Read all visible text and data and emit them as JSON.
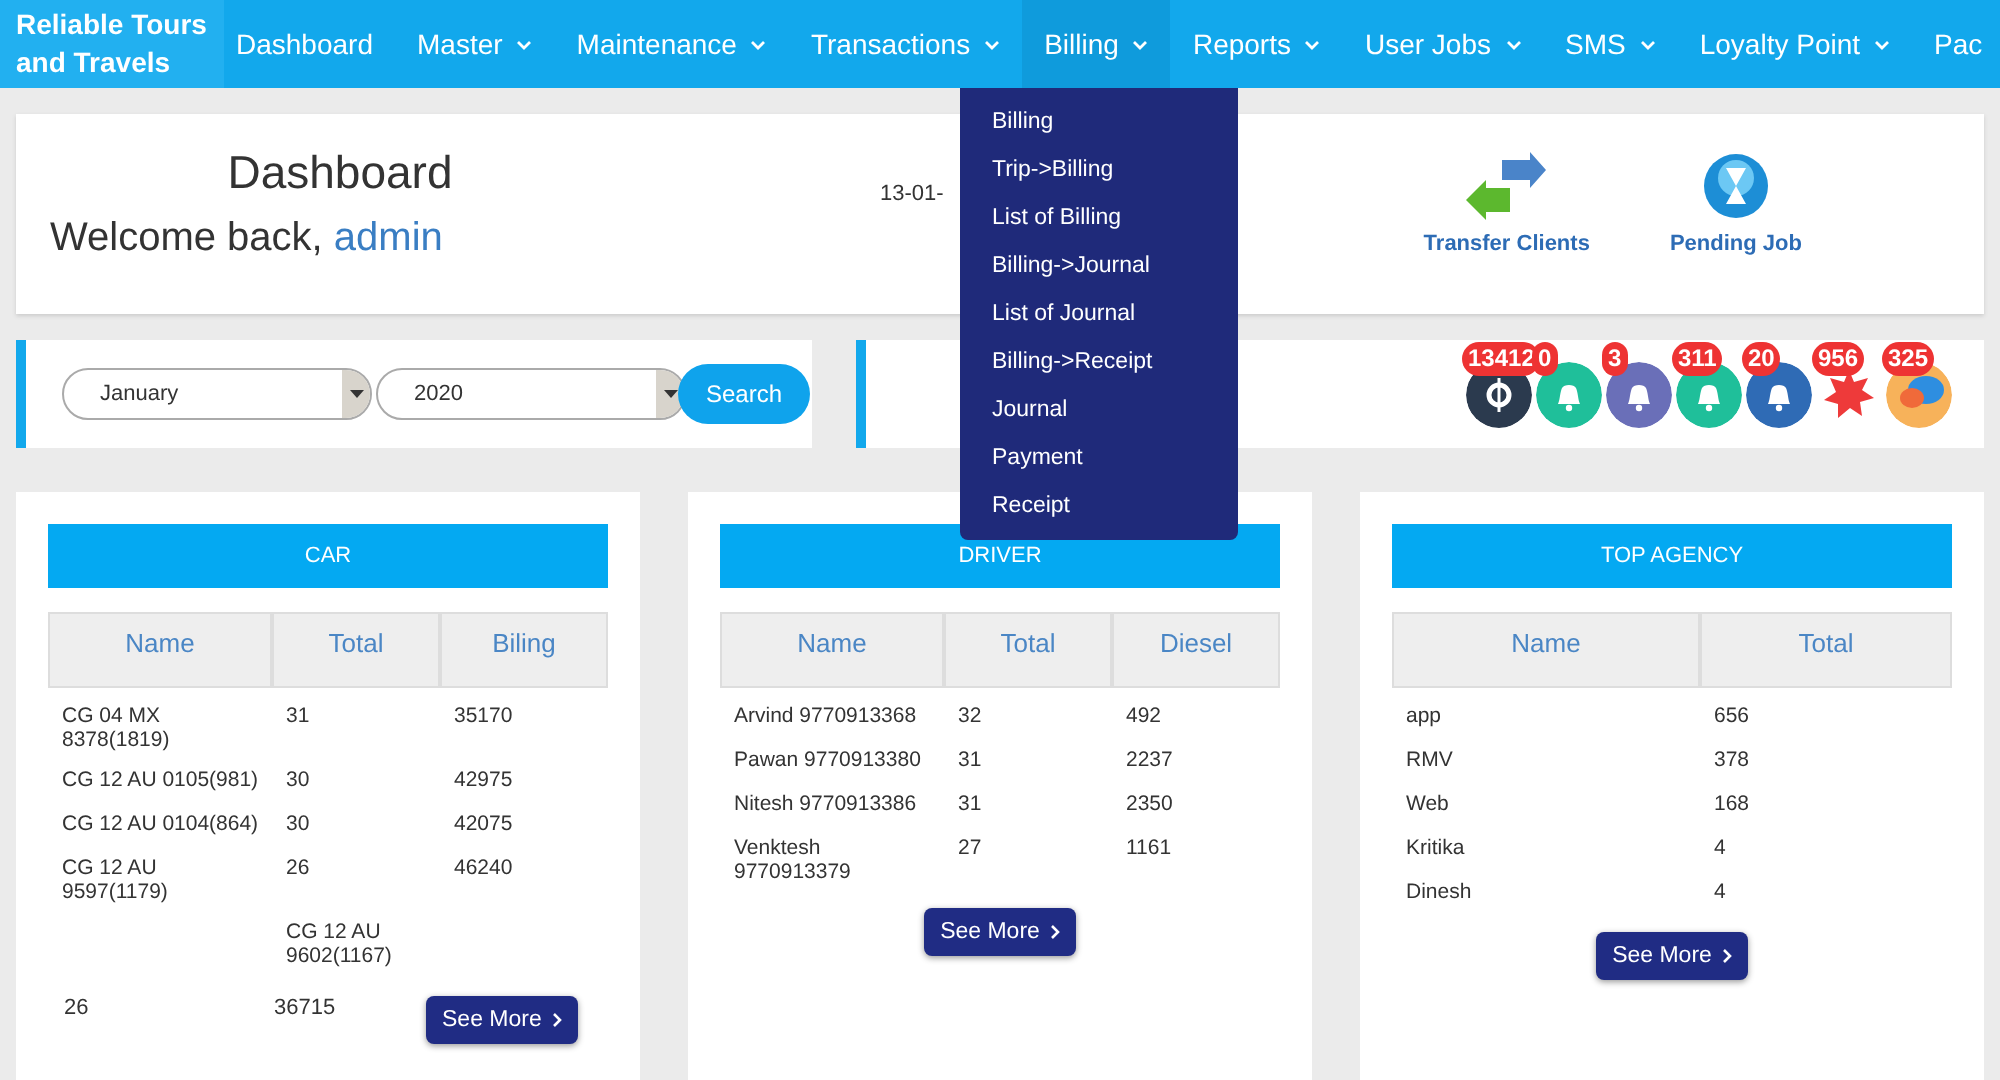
{
  "brand": "Reliable Tours and Travels",
  "nav": [
    {
      "label": "Dashboard",
      "caret": false,
      "expanded": false
    },
    {
      "label": "Master",
      "caret": true,
      "expanded": false
    },
    {
      "label": "Maintenance",
      "caret": true,
      "expanded": false
    },
    {
      "label": "Transactions",
      "caret": true,
      "expanded": false
    },
    {
      "label": "Billing",
      "caret": true,
      "expanded": true
    },
    {
      "label": "Reports",
      "caret": true,
      "expanded": false
    },
    {
      "label": "User Jobs",
      "caret": true,
      "expanded": false
    },
    {
      "label": "SMS",
      "caret": true,
      "expanded": false
    },
    {
      "label": "Loyalty Point",
      "caret": true,
      "expanded": false
    },
    {
      "label": "Pac",
      "caret": false,
      "expanded": false
    }
  ],
  "dropdown": [
    "Billing",
    "Trip->Billing",
    "List of Billing",
    "Billing->Journal",
    "List of Journal",
    "Billing->Receipt",
    "Journal",
    "Payment",
    "Receipt"
  ],
  "header": {
    "title": "Dashboard",
    "welcome": "Welcome back,",
    "user": "admin",
    "date": "13-01-",
    "shortcuts": [
      {
        "kind": "transfer",
        "label": "Transfer Clients"
      },
      {
        "kind": "hourglass",
        "label": "Pending Job"
      }
    ]
  },
  "filter": {
    "month": "January",
    "year": "2020",
    "button": "Search"
  },
  "notifications": [
    {
      "kind": "ring",
      "color": "#2b3a4e",
      "count": "13412"
    },
    {
      "kind": "bell",
      "color": "#1fbf9a",
      "count": "0"
    },
    {
      "kind": "bell",
      "color": "#6a6fb8",
      "count": "3"
    },
    {
      "kind": "bell",
      "color": "#1fbf9a",
      "count": "311"
    },
    {
      "kind": "bell",
      "color": "#2f6bb5",
      "count": "20"
    },
    {
      "kind": "star",
      "color": "#ee3a3a",
      "count": "956"
    },
    {
      "kind": "chat",
      "color": "#f7b25a",
      "count": "325"
    }
  ],
  "cards": [
    {
      "title": "CAR",
      "columns": [
        "Name",
        "Total",
        "Biling"
      ],
      "rows": [
        [
          "CG 04 MX 8378(1819)",
          "31",
          "35170"
        ],
        [
          "CG 12 AU 0105(981)",
          "30",
          "42975"
        ],
        [
          "CG 12 AU 0104(864)",
          "30",
          "42075"
        ],
        [
          "CG 12 AU 9597(1179)",
          "26",
          "46240"
        ],
        [
          "",
          "CG 12 AU 9602(1167)",
          ""
        ]
      ],
      "trailing": [
        "26",
        "36715"
      ],
      "button": "See More"
    },
    {
      "title": "DRIVER",
      "columns": [
        "Name",
        "Total",
        "Diesel"
      ],
      "rows": [
        [
          "Arvind 9770913368",
          "32",
          "492"
        ],
        [
          "Pawan 9770913380",
          "31",
          "2237"
        ],
        [
          "Nitesh 9770913386",
          "31",
          "2350"
        ],
        [
          "Venktesh 9770913379",
          "27",
          "1161"
        ]
      ],
      "button": "See More"
    },
    {
      "title": "TOP AGENCY",
      "columns": [
        "Name",
        "Total"
      ],
      "rows": [
        [
          "app",
          "656"
        ],
        [
          "RMV",
          "378"
        ],
        [
          "Web",
          "168"
        ],
        [
          "Kritika",
          "4"
        ],
        [
          "Dinesh",
          "4"
        ]
      ],
      "button": "See More"
    }
  ]
}
